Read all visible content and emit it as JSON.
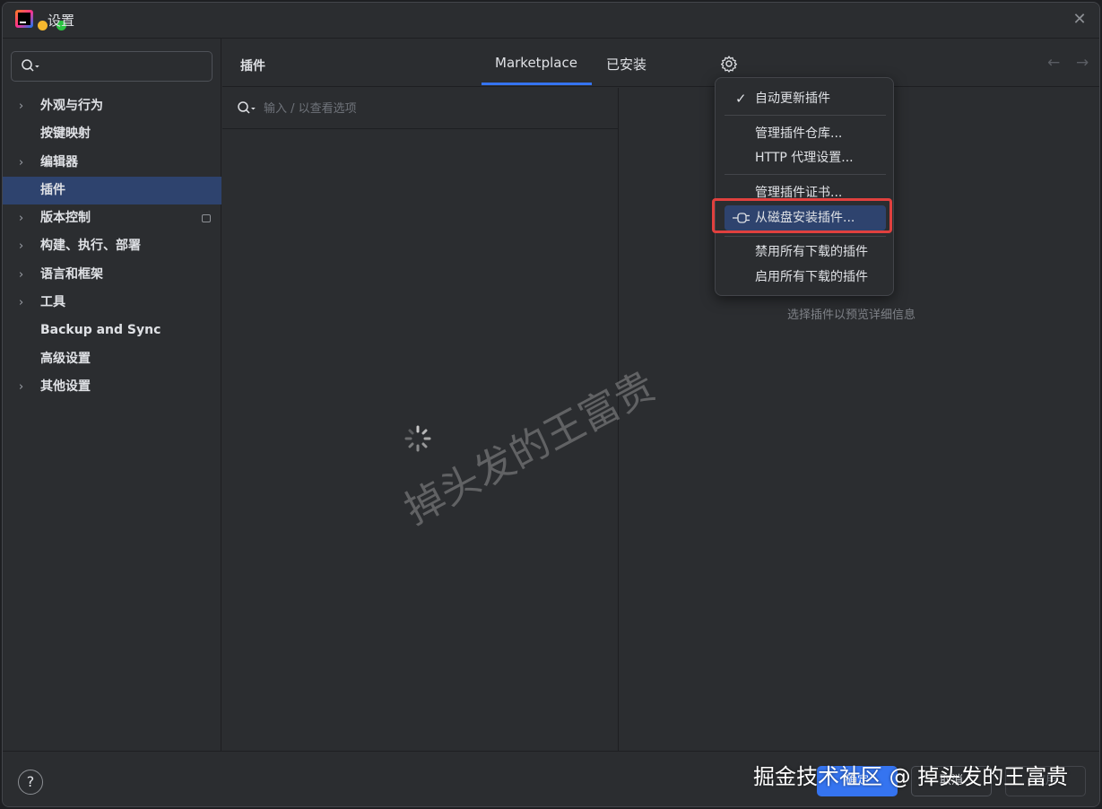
{
  "window": {
    "title": "设置"
  },
  "sidebar": {
    "search_placeholder": "",
    "items": [
      {
        "label": "外观与行为",
        "expandable": true
      },
      {
        "label": "按键映射",
        "expandable": false
      },
      {
        "label": "编辑器",
        "expandable": true
      },
      {
        "label": "插件",
        "expandable": false,
        "selected": true
      },
      {
        "label": "版本控制",
        "expandable": true
      },
      {
        "label": "构建、执行、部署",
        "expandable": true
      },
      {
        "label": "语言和框架",
        "expandable": true
      },
      {
        "label": "工具",
        "expandable": true
      },
      {
        "label": "Backup and Sync",
        "expandable": false
      },
      {
        "label": "高级设置",
        "expandable": false
      },
      {
        "label": "其他设置",
        "expandable": true
      }
    ]
  },
  "plugins": {
    "title": "插件",
    "tabs": [
      {
        "label": "Marketplace",
        "active": true
      },
      {
        "label": "已安装",
        "active": false
      }
    ],
    "search_placeholder": "输入 / 以查看选项",
    "detail_hint": "选择插件以预览详细信息"
  },
  "gear_menu": {
    "items": [
      {
        "label": "自动更新插件",
        "checked": true
      },
      {
        "label": "管理插件仓库..."
      },
      {
        "label": "HTTP 代理设置..."
      },
      {
        "label": "管理插件证书..."
      },
      {
        "label": "从磁盘安装插件...",
        "highlighted": true
      },
      {
        "label": "禁用所有下载的插件"
      },
      {
        "label": "启用所有下载的插件"
      }
    ]
  },
  "footer": {
    "help": "?",
    "ok": "确定",
    "cancel": "取消",
    "apply": "应用"
  },
  "watermarks": {
    "brand": "掘金技术社区 @ 掉头发的王富贵",
    "diagonal": "掉头发的王富贵"
  },
  "colors": {
    "accent": "#3574f0",
    "selection": "#2e436e",
    "highlight_border": "#e0403e"
  }
}
